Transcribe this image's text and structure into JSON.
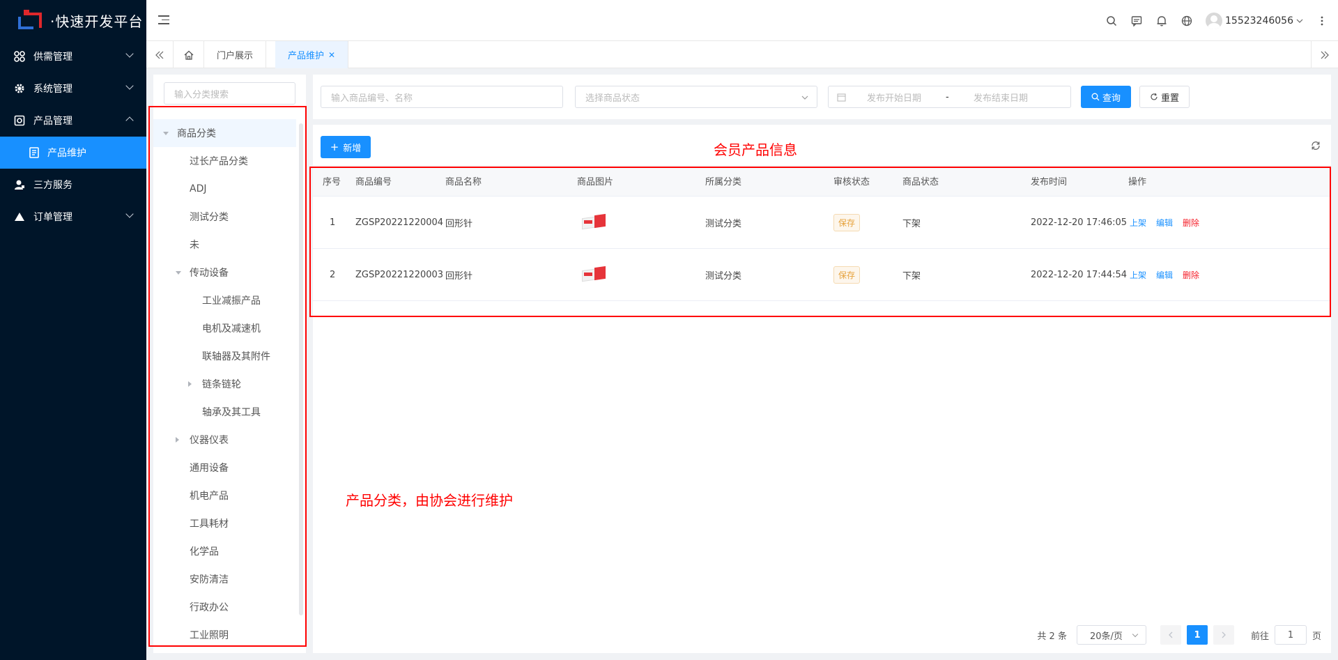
{
  "app": {
    "logo_text": "·快速开发平台"
  },
  "sidebar": {
    "items": [
      {
        "label": "供需管理",
        "icon": "grid-icon",
        "expanded": false
      },
      {
        "label": "系统管理",
        "icon": "gear-icon",
        "expanded": false
      },
      {
        "label": "产品管理",
        "icon": "product-icon",
        "expanded": true
      },
      {
        "label": "三方服务",
        "icon": "user-icon",
        "expanded": false
      },
      {
        "label": "订单管理",
        "icon": "triangle-icon",
        "expanded": false
      }
    ],
    "sub_active": {
      "label": "产品维护",
      "icon": "document-icon"
    }
  },
  "header": {
    "username": "15523246056"
  },
  "tabs": {
    "items": [
      {
        "label": "门户展示"
      },
      {
        "label": "产品维护",
        "active": true
      }
    ]
  },
  "tree": {
    "search_placeholder": "输入分类搜索",
    "nodes": [
      {
        "label": "商品分类",
        "level": 0,
        "arrow": "down"
      },
      {
        "label": "过长产品分类",
        "level": 1
      },
      {
        "label": "ADJ",
        "level": 1
      },
      {
        "label": "测试分类",
        "level": 1
      },
      {
        "label": "未",
        "level": 1
      },
      {
        "label": "传动设备",
        "level": 1,
        "arrow": "down"
      },
      {
        "label": "工业减振产品",
        "level": 2
      },
      {
        "label": "电机及减速机",
        "level": 2
      },
      {
        "label": "联轴器及其附件",
        "level": 2
      },
      {
        "label": "链条链轮",
        "level": 2,
        "arrow": "right"
      },
      {
        "label": "轴承及其工具",
        "level": 2
      },
      {
        "label": "仪器仪表",
        "level": 1,
        "arrow": "right"
      },
      {
        "label": "通用设备",
        "level": 1
      },
      {
        "label": "机电产品",
        "level": 1
      },
      {
        "label": "工具耗材",
        "level": 1
      },
      {
        "label": "化学品",
        "level": 1
      },
      {
        "label": "安防清洁",
        "level": 1
      },
      {
        "label": "行政办公",
        "level": 1
      },
      {
        "label": "工业照明",
        "level": 1
      }
    ]
  },
  "query": {
    "keyword_placeholder": "输入商品编号、名称",
    "status_placeholder": "选择商品状态",
    "start_date_placeholder": "发布开始日期",
    "date_separator": "-",
    "end_date_placeholder": "发布结束日期",
    "search_label": "查询",
    "reset_label": "重置"
  },
  "toolbar": {
    "add_label": "新增"
  },
  "table": {
    "columns": [
      "序号",
      "商品编号",
      "商品名称",
      "商品图片",
      "所属分类",
      "审核状态",
      "商品状态",
      "发布时间",
      "操作"
    ],
    "rows": [
      {
        "index": "1",
        "code": "ZGSP20221220004",
        "name": "回形针",
        "category": "测试分类",
        "audit": "保存",
        "status": "下架",
        "time": "2022-12-20 17:46:05",
        "actions": [
          "上架",
          "编辑",
          "删除"
        ]
      },
      {
        "index": "2",
        "code": "ZGSP20221220003",
        "name": "回形针",
        "category": "测试分类",
        "audit": "保存",
        "status": "下架",
        "time": "2022-12-20 17:44:54",
        "actions": [
          "上架",
          "编辑",
          "删除"
        ]
      }
    ]
  },
  "pagination": {
    "total_text": "共 2 条",
    "page_size": "20条/页",
    "current_page": "1",
    "goto_label": "前往",
    "goto_value": "1",
    "page_unit": "页"
  },
  "annotations": {
    "table_note": "会员产品信息",
    "tree_note": "产品分类，由协会进行维护"
  },
  "colors": {
    "sidebar_bg": "#001529",
    "primary": "#1890ff",
    "danger": "#f5222d",
    "warning": "#e6a23c",
    "annotation": "#ff0000"
  }
}
